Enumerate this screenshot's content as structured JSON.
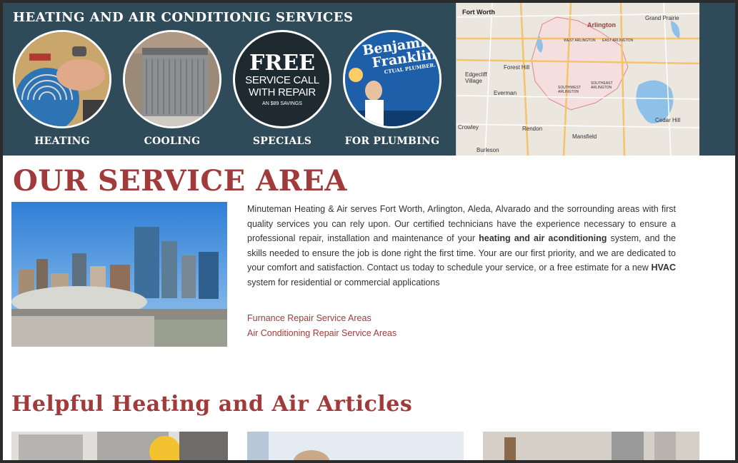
{
  "banner": {
    "title": "HEATING AND AIR CONDITIONIG SERVICES",
    "services": [
      {
        "label": "HEATING",
        "icon": "heating-technician-photo"
      },
      {
        "label": "COOLING",
        "icon": "ac-unit-photo"
      },
      {
        "label": "SPECIALS",
        "icon": "free-service-badge"
      },
      {
        "label": "FOR PLUMBING",
        "icon": "plumbing-van-photo"
      }
    ],
    "specials_badge": {
      "line1": "FREE",
      "line2": "SERVICE CALL",
      "line3": "WITH REPAIR",
      "line4": "AN $89 SAVINGS"
    },
    "plumbing_badge": {
      "brand_line1": "Benjamin",
      "brand_line2": "Franklin",
      "brand_line3": "CTUAL PLUMBER."
    }
  },
  "map": {
    "labels": {
      "fort_worth": "Fort Worth",
      "arlington": "Arlington",
      "grand_prairie": "Grand Prairie",
      "forest_hill": "Forest Hill",
      "everman": "Everman",
      "edgecliff": "Edgecliff Village",
      "rendon": "Rendon",
      "mansfield": "Mansfield",
      "cedar_hill": "Cedar Hill",
      "crowley": "Crowley",
      "burleson": "Burleson",
      "east_arlington": "EAST ARLINGTON",
      "west_arlington": "WEST ARLINGTON",
      "southwest_arlington": "SOUTHWEST ARLINGTON",
      "southeast_arlington": "SOUTHEAST ARLINGTON"
    }
  },
  "main": {
    "title": "OUR SERVICE AREA",
    "paragraph_part1": "Minuteman Heating & Air serves Fort Worth, Arlington, Aleda, Alvarado and the sorrounding areas with first quality services you can rely upon. Our certified technicians have the experience necessary to ensure a professional repair, installation and maintenance of your ",
    "paragraph_bold1": "heating and air aconditioning",
    "paragraph_part2": " system, and the skills needed to ensure the job is done right the first time. Your are our first priority, and we are dedicated to your comfort and satisfaction. Contact us today to schedule your service, or a free estimate for a new ",
    "paragraph_bold2": "HVAC",
    "paragraph_part3": " system for residential or commercial applications",
    "links": [
      "Furnance Repair Service Areas",
      "Air Conditioning Repair Service Areas"
    ],
    "articles_title": "Helpful Heating and Air Articles"
  },
  "colors": {
    "banner_bg": "#2f4a58",
    "accent_red": "#a13b3b",
    "text": "#333333"
  }
}
